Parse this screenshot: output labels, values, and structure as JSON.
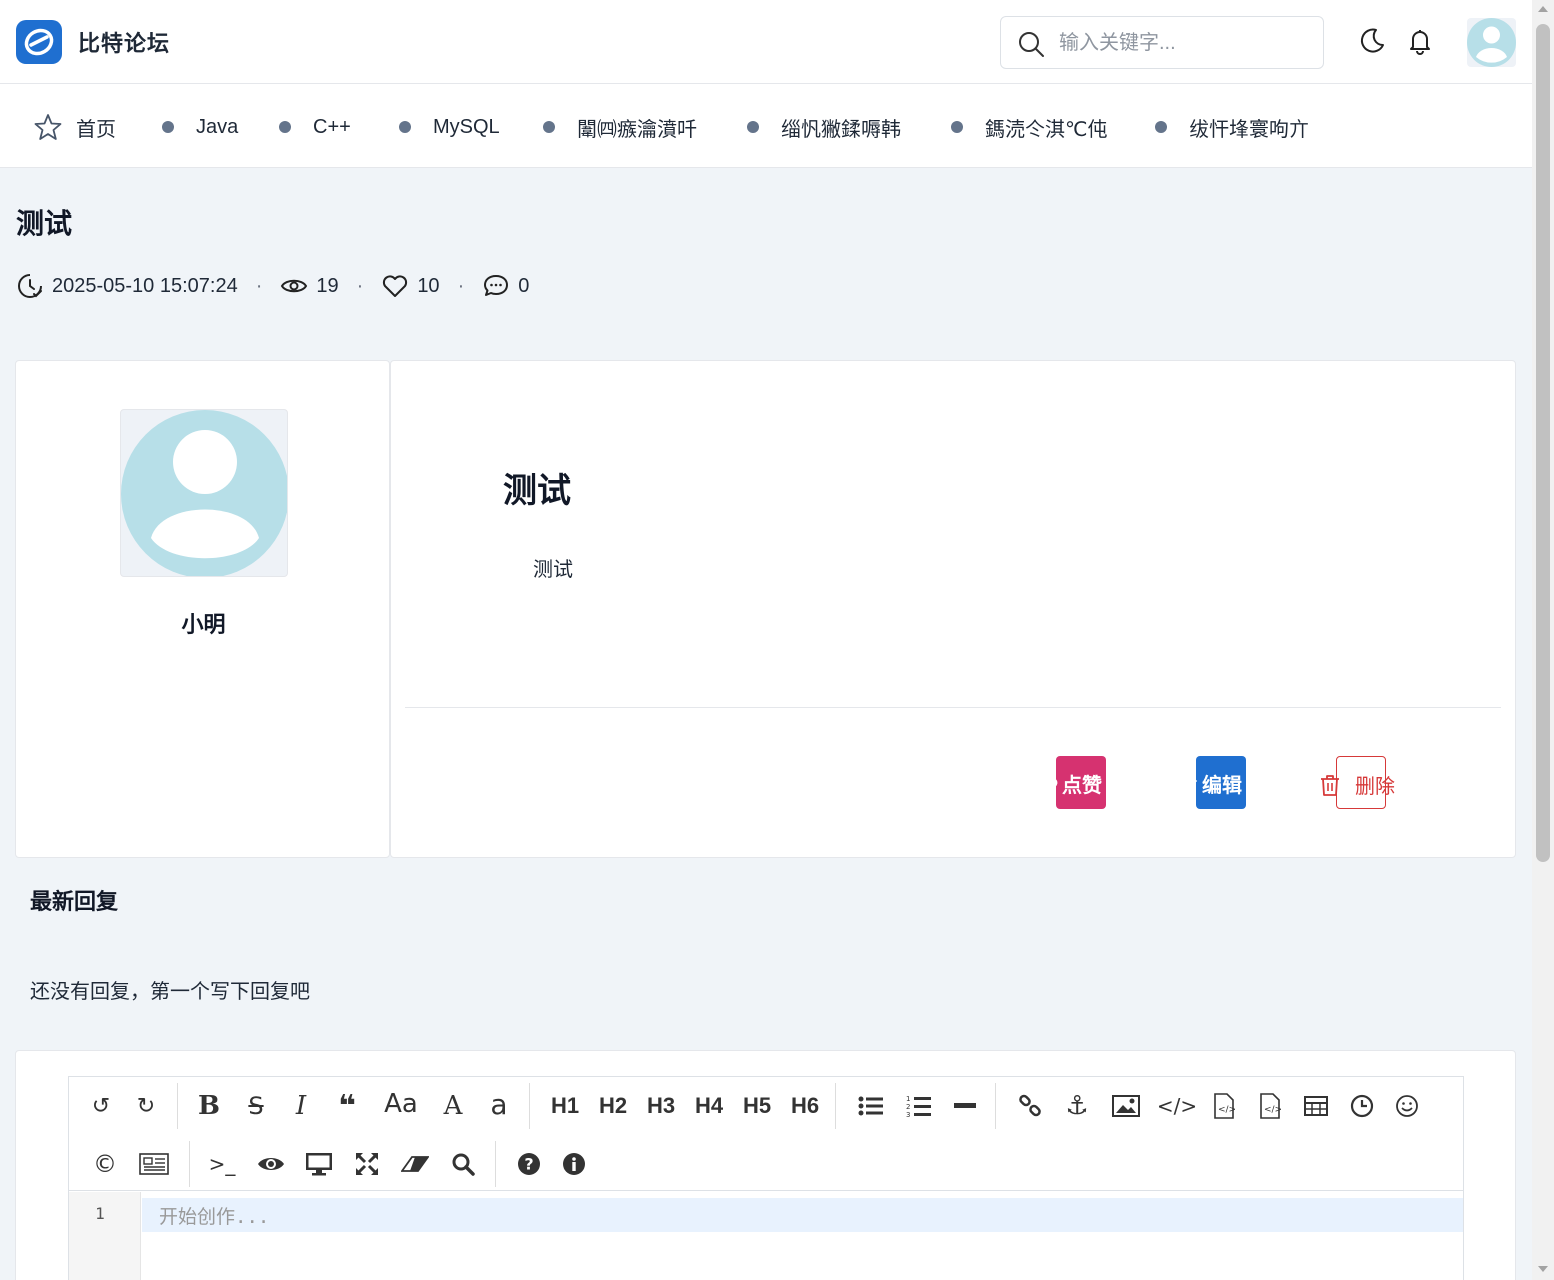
{
  "header": {
    "brand": "比特论坛",
    "search_placeholder": "输入关键字...",
    "icons": [
      "logo-icon",
      "search-icon",
      "moon-icon",
      "bell-icon",
      "avatar"
    ]
  },
  "nav": {
    "home": "首页",
    "items": [
      "Java",
      "C++",
      "MySQL",
      "闈㈣瘯瀹濆吀",
      "缁忛獙鍒嗕韩",
      "鎷涜仒淇℃伅",
      "绂忓埄寰呴亣"
    ]
  },
  "post": {
    "title": "测试",
    "datetime": "2025-05-10 15:07:24",
    "views": "19",
    "likes": "10",
    "comments": "0",
    "author": "小明",
    "content_heading": "测试",
    "content_text": "测试"
  },
  "actions": {
    "like": "点赞",
    "edit": "编辑",
    "delete": "删除"
  },
  "replies": {
    "title": "最新回复",
    "empty": "还没有回复，第一个写下回复吧"
  },
  "editor": {
    "headings": [
      "H1",
      "H2",
      "H3",
      "H4",
      "H5",
      "H6"
    ],
    "line_number": "1",
    "placeholder": "开始创作..."
  },
  "colors": {
    "primary": "#1f6fd0",
    "like": "#d63270",
    "danger": "#d63939",
    "page_bg": "#f0f4f8"
  }
}
